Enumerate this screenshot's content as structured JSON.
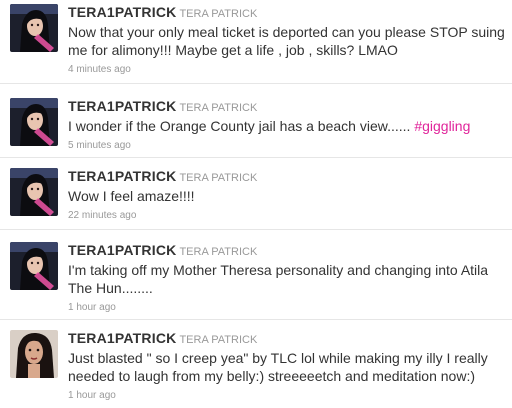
{
  "tweets": [
    {
      "screen_name": "TERA1PATRICK",
      "full_name": "TERA PATRICK",
      "text": "Now that your only meal ticket is deported can you please STOP suing me for alimony!!! Maybe get a life , job , skills? LMAO",
      "hashtag": "",
      "time": "4 minutes ago",
      "avatar_icon": "profile-photo-icon"
    },
    {
      "screen_name": "TERA1PATRICK",
      "full_name": "TERA PATRICK",
      "text": "I wonder if the Orange County jail has a beach view...... ",
      "hashtag": "#giggling",
      "time": "5 minutes ago",
      "avatar_icon": "profile-photo-icon"
    },
    {
      "screen_name": "TERA1PATRICK",
      "full_name": "TERA PATRICK",
      "text": "Wow I feel amaze!!!!",
      "hashtag": "",
      "time": "22 minutes ago",
      "avatar_icon": "profile-photo-icon"
    },
    {
      "screen_name": "TERA1PATRICK",
      "full_name": "TERA PATRICK",
      "text": "I'm taking off my Mother Theresa personality and changing into Atila The Hun........",
      "hashtag": "",
      "time": "1 hour ago",
      "avatar_icon": "profile-photo-icon"
    },
    {
      "screen_name": "TERA1PATRICK",
      "full_name": "TERA PATRICK",
      "text": "Just blasted \" so I creep yea\" by TLC lol while making my illy I really needed to laugh from my belly:) streeeeetch and meditation now:)",
      "hashtag": "",
      "time": "1 hour ago",
      "avatar_icon": "profile-photo-icon"
    }
  ],
  "colors": {
    "hashtag": "#e0249a",
    "meta": "#999999",
    "text": "#333333",
    "divider": "#e6e6e6"
  }
}
